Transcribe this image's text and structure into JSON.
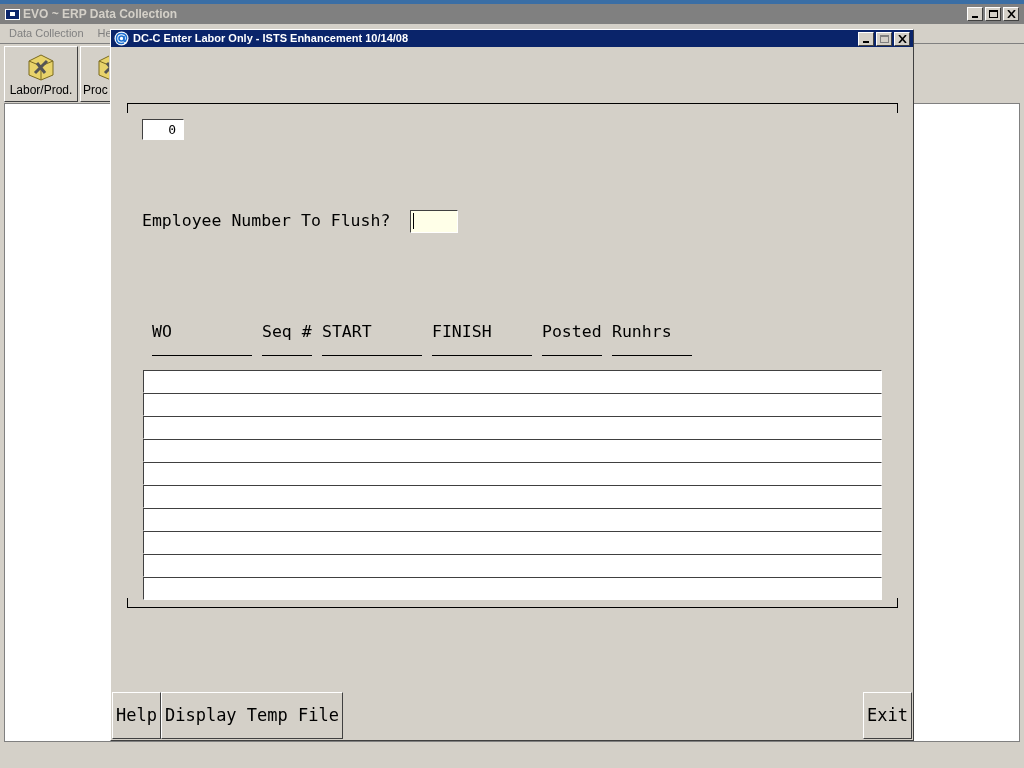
{
  "window": {
    "title": "EVO ~ ERP Data Collection"
  },
  "menu": [
    "Data Collection",
    "He"
  ],
  "toolbar": [
    "Labor/Prod.",
    "Proc"
  ],
  "dialog": {
    "title": "DC-C  Enter Labor Only - ISTS Enhancement 10/14/08",
    "counter_field": {
      "value": "0"
    },
    "prompt": {
      "label": "Employee Number To Flush?"
    },
    "grid": {
      "columns": [
        "WO",
        "Seq #",
        "START",
        "FINISH",
        "Posted",
        "Runhrs"
      ]
    },
    "buttons_left": [
      "Help",
      "Display Temp File"
    ],
    "buttons_right": [
      "Exit"
    ]
  }
}
